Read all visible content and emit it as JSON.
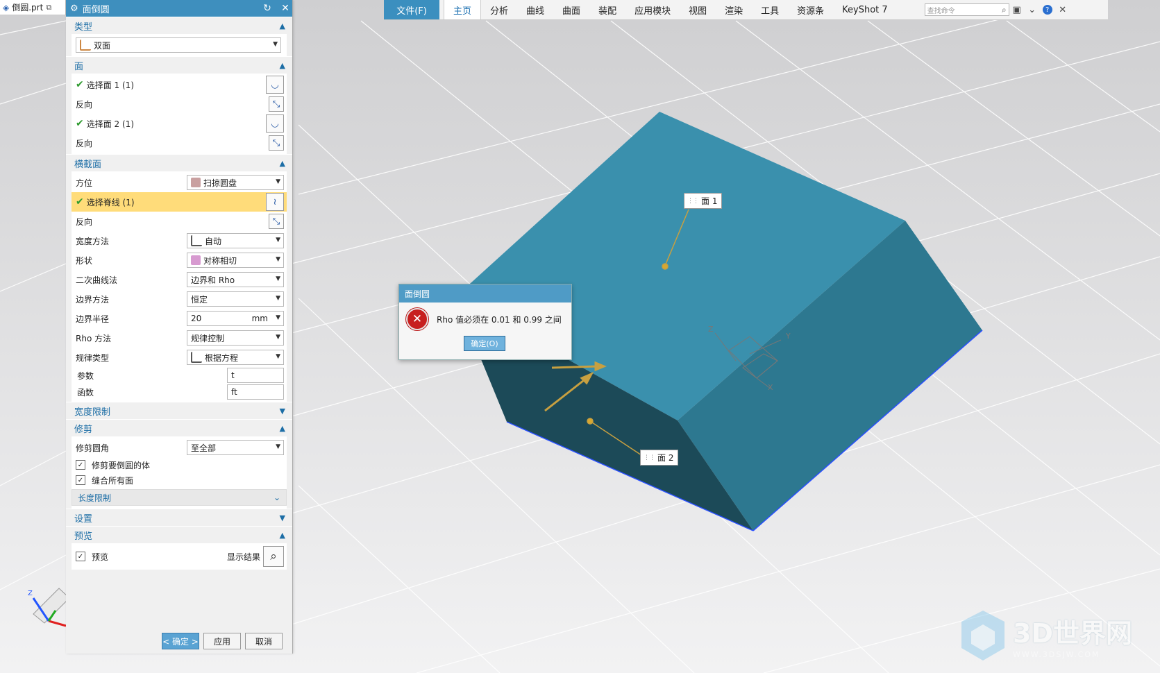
{
  "file_tab": {
    "name": "倒圆.prt"
  },
  "ribbon": {
    "file_menu": "文件(F)",
    "tabs": [
      "主页",
      "分析",
      "曲线",
      "曲面",
      "装配",
      "应用模块",
      "视图",
      "渲染",
      "工具",
      "资源条",
      "KeyShot 7"
    ],
    "active_tab": "主页",
    "search_placeholder": "查找命令"
  },
  "panel": {
    "title": "面倒圆",
    "sections": {
      "type": {
        "label": "类型",
        "value": "双面"
      },
      "face": {
        "label": "面",
        "select1": "选择面 1 (1)",
        "reverse1": "反向",
        "select2": "选择面 2 (1)",
        "reverse2": "反向"
      },
      "cross": {
        "label": "横截面",
        "orientation_label": "方位",
        "orientation_value": "扫掠圆盘",
        "spine": "选择脊线 (1)",
        "reverse": "反向",
        "width_method_label": "宽度方法",
        "width_method_value": "自动",
        "shape_label": "形状",
        "shape_value": "对称相切",
        "conic_label": "二次曲线法",
        "conic_value": "边界和 Rho",
        "boundary_method_label": "边界方法",
        "boundary_method_value": "恒定",
        "boundary_radius_label": "边界半径",
        "boundary_radius_value": "20",
        "boundary_radius_unit": "mm",
        "rho_method_label": "Rho 方法",
        "rho_method_value": "规律控制",
        "law_type_label": "规律类型",
        "law_type_value": "根据方程",
        "param_label": "参数",
        "param_value": "t",
        "func_label": "函数",
        "func_value": "ft"
      },
      "width_limit": {
        "label": "宽度限制"
      },
      "trim": {
        "label": "修剪",
        "trim_corner_label": "修剪圆角",
        "trim_corner_value": "至全部",
        "trim_body": "修剪要倒圆的体",
        "stitch": "缝合所有面",
        "length_limit": "长度限制"
      },
      "settings": {
        "label": "设置"
      },
      "preview": {
        "label": "预览",
        "preview_cb": "预览",
        "show_result": "显示结果"
      }
    },
    "footer": {
      "ok": "< 确定 >",
      "apply": "应用",
      "cancel": "取消"
    }
  },
  "error_dialog": {
    "title": "面倒圆",
    "message": "Rho 值必须在 0.01 和 0.99 之间",
    "ok": "确定(O)"
  },
  "callouts": {
    "face1": "面 1",
    "face2": "面 2"
  },
  "triad_labels": {
    "z": "Z",
    "y": "Y",
    "x": "X"
  },
  "view_triad": {
    "z": "Z"
  },
  "watermark": {
    "text": "3D世界网",
    "sub": "WWW.3DSJW.COM"
  },
  "colors": {
    "accent": "#3e8fbe",
    "solid_top": "#3a90ad",
    "solid_side": "#1f5566",
    "highlight": "#ffdc7a"
  }
}
